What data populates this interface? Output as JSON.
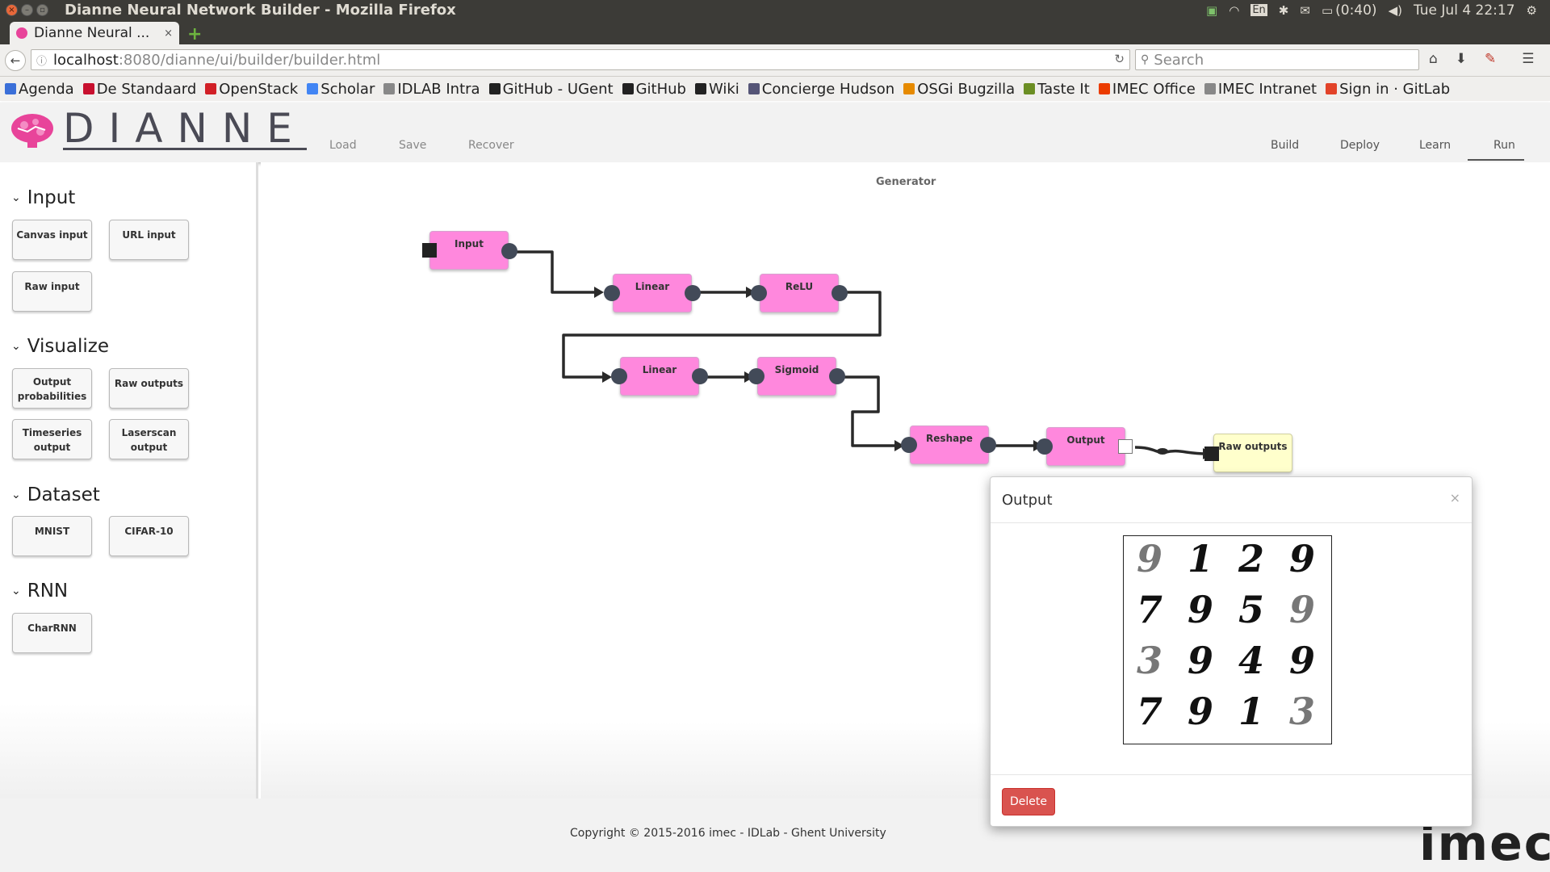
{
  "os": {
    "window_title": "Dianne Neural Network Builder - Mozilla Firefox",
    "lang": "En",
    "battery": "(0:40)",
    "clock": "Tue Jul  4 22:17"
  },
  "browser": {
    "tab_label": "Dianne Neural ...",
    "tab_close": "×",
    "new_tab": "+",
    "url_host": "localhost",
    "url_path": ":8080/dianne/ui/builder/builder.html",
    "search_placeholder": "Search",
    "bookmarks": [
      {
        "label": "Agenda",
        "color": "#3a6fd8"
      },
      {
        "label": "De Standaard",
        "color": "#c8102e"
      },
      {
        "label": "OpenStack",
        "color": "#d11f26"
      },
      {
        "label": "Scholar",
        "color": "#4285f4"
      },
      {
        "label": "IDLAB Intra",
        "color": "#888888"
      },
      {
        "label": "GitHub - UGent",
        "color": "#222222"
      },
      {
        "label": "GitHub",
        "color": "#222222"
      },
      {
        "label": "Wiki",
        "color": "#222222"
      },
      {
        "label": "Concierge Hudson",
        "color": "#555577"
      },
      {
        "label": "OSGi Bugzilla",
        "color": "#e68a00"
      },
      {
        "label": "Taste It",
        "color": "#6b8e23"
      },
      {
        "label": "IMEC Office",
        "color": "#eb3c00"
      },
      {
        "label": "IMEC Intranet",
        "color": "#888888"
      },
      {
        "label": "Sign in · GitLab",
        "color": "#e24329"
      }
    ]
  },
  "app": {
    "brand": "DIANNE",
    "file_menu": [
      "Load",
      "Save",
      "Recover"
    ],
    "mode_tabs": [
      "Build",
      "Deploy",
      "Learn",
      "Run"
    ],
    "active_mode": "Run"
  },
  "sidebar": {
    "categories": [
      {
        "title": "Input",
        "items": [
          "Canvas input",
          "URL input",
          "Raw input"
        ]
      },
      {
        "title": "Visualize",
        "items": [
          "Output\nprobabilities",
          "Raw outputs",
          "Timeseries\noutput",
          "Laserscan\noutput"
        ]
      },
      {
        "title": "Dataset",
        "items": [
          "MNIST",
          "CIFAR-10"
        ]
      },
      {
        "title": "RNN",
        "items": [
          "CharRNN"
        ]
      }
    ]
  },
  "canvas": {
    "title": "Generator",
    "nodes": {
      "input": "Input",
      "linear1": "Linear",
      "relu": "ReLU",
      "linear2": "Linear",
      "sigmoid": "Sigmoid",
      "reshape": "Reshape",
      "output": "Output",
      "raw_outputs": "Raw outputs"
    },
    "colors": {
      "module": "#ff88dd",
      "visualizer": "#ffffcc",
      "port": "#424a58"
    }
  },
  "dialog": {
    "title": "Output",
    "close": "×",
    "delete_label": "Delete",
    "delete_color": "#d9534f",
    "image_description_digits": [
      "9",
      "1",
      "2",
      "9",
      "7",
      "9",
      "5",
      "9",
      "3",
      "9",
      "4",
      "9",
      "7",
      "9",
      "1",
      "3"
    ]
  },
  "footer": {
    "copyright": "Copyright © 2015-2016 imec - IDLab - Ghent University",
    "logo": "imec"
  }
}
